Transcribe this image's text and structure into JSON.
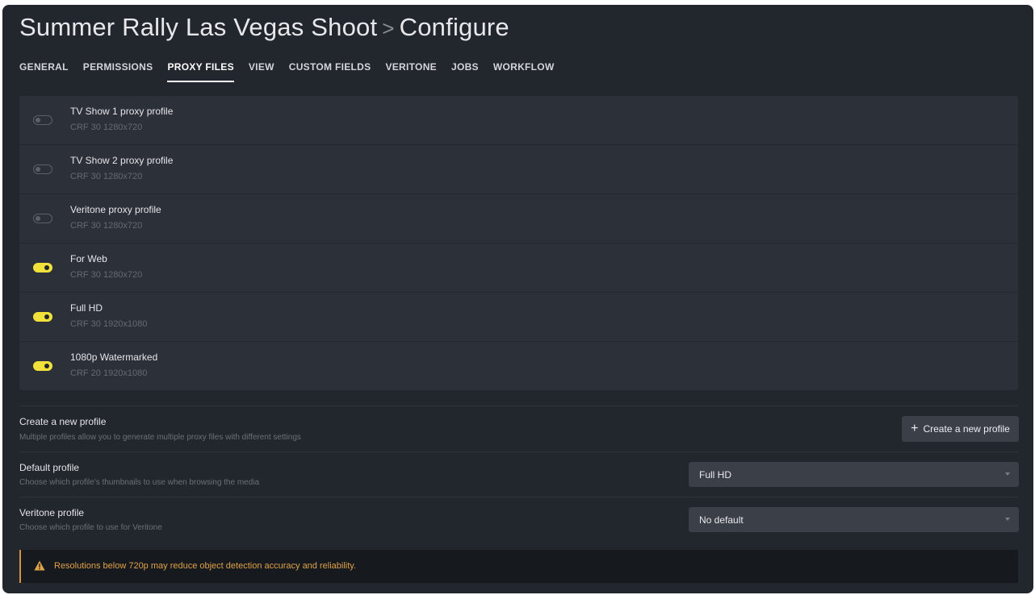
{
  "header": {
    "project": "Summer Rally Las Vegas Shoot",
    "separator": ">",
    "page": "Configure"
  },
  "tabs": [
    {
      "label": "GENERAL",
      "active": false
    },
    {
      "label": "PERMISSIONS",
      "active": false
    },
    {
      "label": "PROXY FILES",
      "active": true
    },
    {
      "label": "VIEW",
      "active": false
    },
    {
      "label": "CUSTOM FIELDS",
      "active": false
    },
    {
      "label": "VERITONE",
      "active": false
    },
    {
      "label": "JOBS",
      "active": false
    },
    {
      "label": "WORKFLOW",
      "active": false
    }
  ],
  "profiles": [
    {
      "name": "TV Show 1 proxy profile",
      "desc": "CRF 30 1280x720",
      "enabled": false
    },
    {
      "name": "TV Show 2 proxy profile",
      "desc": "CRF 30 1280x720",
      "enabled": false
    },
    {
      "name": "Veritone proxy profile",
      "desc": "CRF 30 1280x720",
      "enabled": false
    },
    {
      "name": "For Web",
      "desc": "CRF 30 1280x720",
      "enabled": true
    },
    {
      "name": "Full HD",
      "desc": "CRF 30 1920x1080",
      "enabled": true
    },
    {
      "name": "1080p Watermarked",
      "desc": "CRF 20 1920x1080",
      "enabled": true
    }
  ],
  "create_profile": {
    "title": "Create a new profile",
    "subtitle": "Multiple profiles allow you to generate multiple proxy files with different settings",
    "button_label": "Create a new profile",
    "button_icon": "plus-icon"
  },
  "default_profile": {
    "title": "Default profile",
    "subtitle": "Choose which profile's thumbnails to use when browsing the media",
    "value": "Full HD"
  },
  "veritone_profile": {
    "title": "Veritone profile",
    "subtitle": "Choose which profile to use for Veritone",
    "value": "No default"
  },
  "warning": {
    "icon": "warning-triangle-icon",
    "text": "Resolutions below 720p may reduce object detection accuracy and reliability."
  },
  "colors": {
    "background": "#22262d",
    "panel": "#2c3039",
    "toggle_on": "#f2e13a",
    "warning": "#e0a24a"
  }
}
